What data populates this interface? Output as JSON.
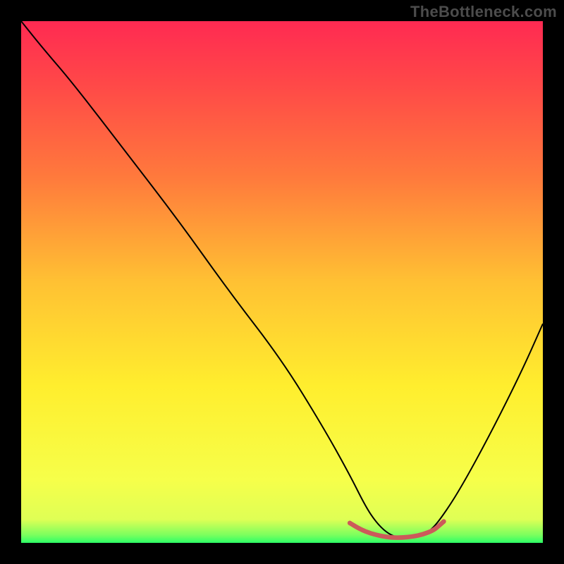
{
  "watermark": "TheBottleneck.com",
  "chart_data": {
    "type": "line",
    "title": "",
    "xlabel": "",
    "ylabel": "",
    "xlim": [
      0,
      100
    ],
    "ylim": [
      0,
      100
    ],
    "grid": false,
    "legend": false,
    "gradient_stops": [
      {
        "offset": 0.0,
        "color": "#ff2a52"
      },
      {
        "offset": 0.12,
        "color": "#ff4848"
      },
      {
        "offset": 0.3,
        "color": "#ff7a3c"
      },
      {
        "offset": 0.5,
        "color": "#ffc133"
      },
      {
        "offset": 0.7,
        "color": "#ffee2e"
      },
      {
        "offset": 0.88,
        "color": "#f6ff4a"
      },
      {
        "offset": 0.955,
        "color": "#dfff55"
      },
      {
        "offset": 0.985,
        "color": "#7bff5e"
      },
      {
        "offset": 1.0,
        "color": "#2cff66"
      }
    ],
    "series": [
      {
        "name": "bottleneck-curve",
        "stroke": "#000000",
        "stroke_width": 2.0,
        "x": [
          0,
          4,
          10,
          20,
          30,
          40,
          50,
          58,
          63,
          66,
          68,
          70,
          72,
          74,
          76,
          78,
          80,
          84,
          90,
          96,
          100
        ],
        "values": [
          100,
          95,
          88,
          75,
          62,
          48,
          35,
          22,
          13,
          7,
          4,
          2,
          1,
          1,
          1,
          2,
          4,
          10,
          21,
          33,
          42
        ]
      },
      {
        "name": "valley-marker",
        "stroke": "#cc5a5a",
        "stroke_width": 6.5,
        "linecap": "round",
        "x": [
          63,
          65,
          67,
          69,
          71,
          73,
          75,
          77,
          79,
          80,
          81
        ],
        "values": [
          3.8,
          2.6,
          1.8,
          1.3,
          1.0,
          1.0,
          1.2,
          1.6,
          2.4,
          3.2,
          4.1
        ]
      }
    ]
  }
}
